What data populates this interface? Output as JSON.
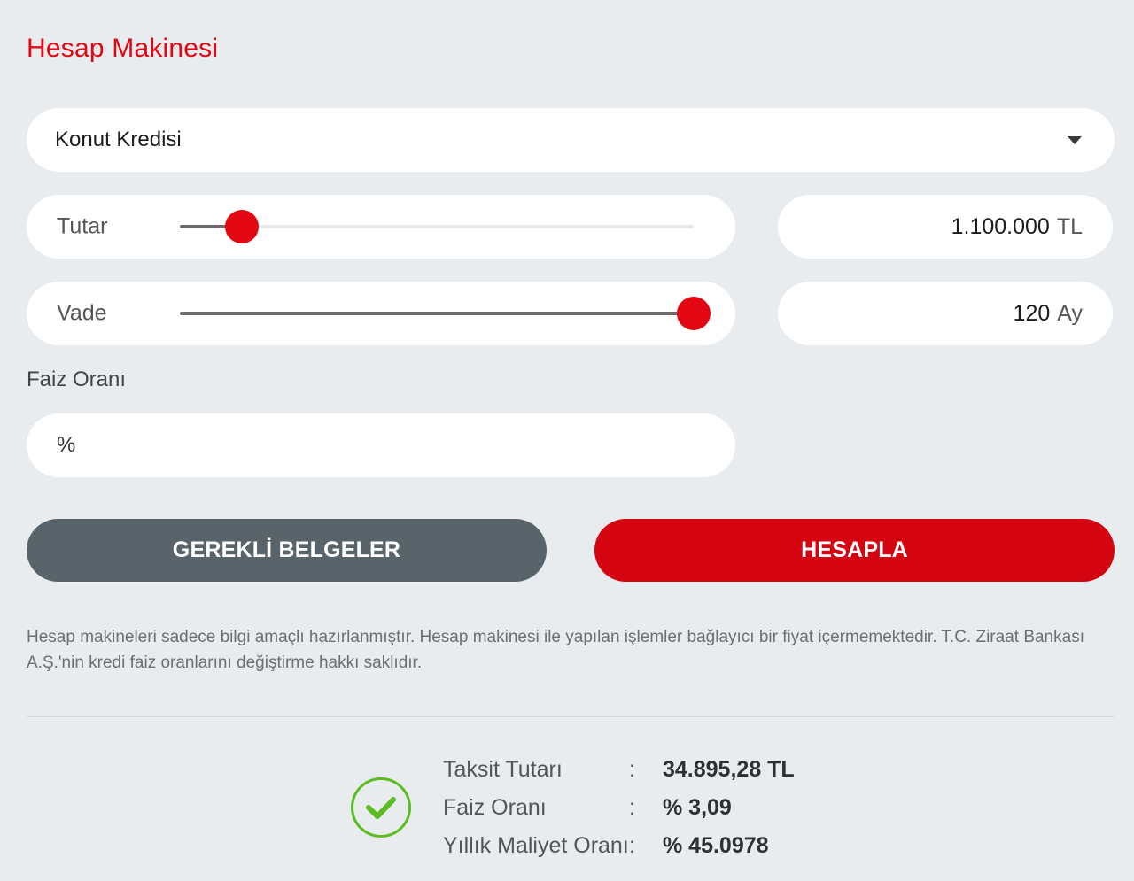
{
  "title": "Hesap Makinesi",
  "loan_type": {
    "selected": "Konut Kredisi",
    "icon": "chevron-down-icon"
  },
  "amount": {
    "label": "Tutar",
    "value": "1.100.000",
    "unit": "TL",
    "slider_fraction": 0.12
  },
  "term": {
    "label": "Vade",
    "value": "120",
    "unit": "Ay",
    "slider_fraction": 1.0
  },
  "interest": {
    "heading": "Faiz Oranı",
    "prefix": "%",
    "value": ""
  },
  "buttons": {
    "documents": "GEREKLİ BELGELER",
    "calculate": "HESAPLA"
  },
  "disclaimer": "Hesap makineleri sadece bilgi amaçlı hazırlanmıştır. Hesap makinesi ile yapılan işlemler bağlayıcı bir fiyat içermemektedir. T.C. Ziraat Bankası A.Ş.'nin kredi faiz oranlarını değiştirme hakkı saklıdır.",
  "results": {
    "icon": "check-circle-icon",
    "rows": [
      {
        "label": "Taksit Tutarı",
        "colon": ":",
        "value": "34.895,28 TL"
      },
      {
        "label": "Faiz Oranı",
        "colon": ":",
        "value": "% 3,09"
      },
      {
        "label": "Yıllık Maliyet Oranı",
        "colon": ":",
        "value": "% 45.0978"
      }
    ]
  },
  "colors": {
    "accent": "#e30613",
    "button_primary": "#d40510",
    "button_secondary": "#58636a",
    "success": "#5cbc21"
  }
}
